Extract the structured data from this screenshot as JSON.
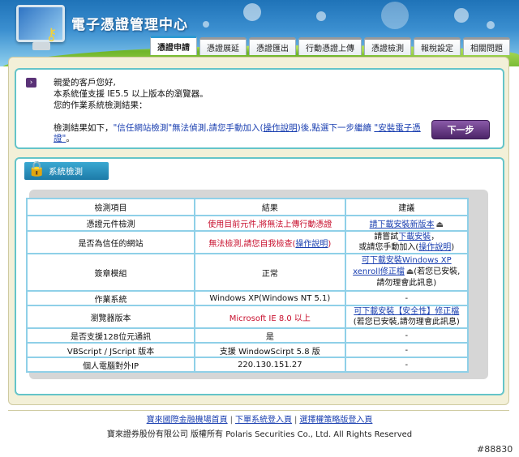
{
  "header": {
    "site_title": "電子憑證管理中心"
  },
  "tabs": [
    {
      "label": "憑證申請",
      "active": true
    },
    {
      "label": "憑證展延"
    },
    {
      "label": "憑證匯出"
    },
    {
      "label": "行動憑證上傳"
    },
    {
      "label": "憑證檢測"
    },
    {
      "label": "報稅設定"
    },
    {
      "label": "相關問題"
    }
  ],
  "notice": {
    "greeting": "親愛的客戶您好,",
    "line2": "本系統僅支援 IE5.5 以上版本的瀏覽器。",
    "line3": "您的作業系統檢測結果：",
    "result_prefix": "檢測結果如下，",
    "result_quoted": "\"信任網站檢測\"",
    "result_mid": "無法偵測,請您手動加入(",
    "result_link": "操作說明",
    "result_after": ")後,點選下一步繼續",
    "install_link": "\"安裝電子憑證\"",
    "result_end": "。",
    "next_button": "下一步"
  },
  "check": {
    "title": "系統檢測",
    "headers": [
      "檢測項目",
      "結果",
      "建議"
    ],
    "rows": [
      {
        "item": "憑證元件檢測",
        "result": "使用目前元件,將無法上傳行動憑證",
        "suggest_link": "請下載安裝新版本"
      },
      {
        "item": "是否為信任的網站",
        "result_prefix": "無法檢測,請您自我檢查(",
        "result_link": "操作說明",
        "result_suffix": ")",
        "suggest_line1_prefix": "請嘗試",
        "suggest_line1_link": "下載安裝",
        "suggest_line1_suffix": "，",
        "suggest_line2_prefix": "或請您手動加入(",
        "suggest_line2_link": "操作說明",
        "suggest_line2_suffix": ")"
      },
      {
        "item": "簽章模組",
        "result": "正常",
        "suggest_link1": "可下載安裝Windows XP",
        "suggest_link2": "xenroll修正檔",
        "suggest_after": "(若您已安裝,",
        "suggest_line3": "請勿理會此訊息)"
      },
      {
        "item": "作業系統",
        "result": "Windows XP(Windows NT 5.1)",
        "suggest": "-"
      },
      {
        "item": "瀏覽器版本",
        "result": "Microsoft IE 8.0 以上",
        "suggest_link": "可下載安裝【安全性】修正檔",
        "suggest_line2": "(若您已安裝,請勿理會此訊息)"
      },
      {
        "item": "是否支援128位元通訊",
        "result": "是",
        "suggest": "-"
      },
      {
        "item": "VBScript / JScript 版本",
        "result": "支援 WindowScirpt 5.8 版",
        "suggest": "-"
      },
      {
        "item": "個人電腦對外IP",
        "result": "220.130.151.27",
        "suggest": "-"
      }
    ]
  },
  "footer": {
    "link1": "寶來國際金融機場首頁",
    "link2": "下單系統登入頁",
    "link3": "選擇權策略版登入頁",
    "separator": "|",
    "copyright": "寶來證券股份有限公司 版權所有 Polaris Securities Co., Ltd. All Rights Reserved"
  },
  "watermark": "#88830"
}
